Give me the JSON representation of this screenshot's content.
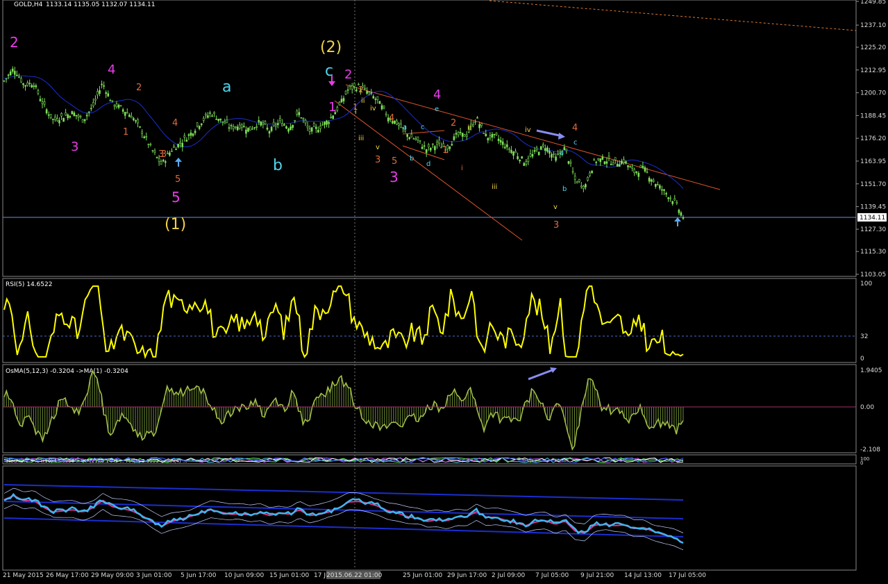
{
  "window": {
    "symbol_title": "GOLD,H4",
    "ohlc": "1133.14 1135.05 1132.07 1134.11",
    "last_price": "1134.11",
    "date_tag": "2015.06.22 01:00"
  },
  "panels": {
    "rsi_label": "RSI(5) 14.6522",
    "osma_label": "OsMA(5,12,3) -0.3204  ->MA(1) -0.3204",
    "stoch_label": "Stoch.3.1.9 ... ((10) 13.6356 ... MA(21) 3.1442 ... MA(1) 2.3553 ... MA(4) ..."
  },
  "colors": {
    "background": "#000000",
    "candles": "#7fe15a",
    "ma_blue": "#1a2fd0",
    "rsi": "#ffff00",
    "osma": "#6e8a33",
    "channel": "#e0552c",
    "magenta": "#e83ce8",
    "cyan": "#4dd6ef",
    "wave_yellow": "#f2d34a",
    "wave_orange": "#e06b3c",
    "arrow_purple": "#8a8cf0",
    "arrow_blue": "#5aa9ef"
  },
  "chart_data": {
    "type": "candlestick",
    "timeframe": "H4",
    "price_axis_ticks": [
      1249.85,
      1237.1,
      1225.2,
      1212.95,
      1200.7,
      1188.45,
      1176.2,
      1163.95,
      1151.7,
      1139.45,
      1127.3,
      1115.3,
      1103.05
    ],
    "price_tick_labels": [
      "1249.85",
      "1237.10",
      "1225.20",
      "1212.95",
      "1200.70",
      "1188.45",
      "1176.20",
      "1163.95",
      "1151.70",
      "1139.45",
      "1127.30",
      "1115.30",
      "1103.05"
    ],
    "time_labels": [
      "21 May 2015",
      "26 May 17:00",
      "29 May 09:00",
      "3 Jun 01:00",
      "5 Jun 17:00",
      "10 Jun 09:00",
      "15 Jun 01:00",
      "17 Jun",
      "2015.06.22 01:00",
      "25 Jun 01:00",
      "29 Jun 17:00",
      "2 Jul 09:00",
      "7 Jul 05:00",
      "9 Jul 21:00",
      "14 Jul 13:00",
      "17 Jul 05:00"
    ],
    "rsi_levels": [
      100,
      32,
      0
    ],
    "rsi_tick_labels": [
      "100",
      "32",
      "0"
    ],
    "osma_levels": [
      1.9405,
      0.0,
      -2.108
    ],
    "osma_tick_labels": [
      "1.9405",
      "0.00",
      "-2.108"
    ],
    "stoch_tick_labels": [
      "100",
      "0"
    ],
    "price_path": [
      [
        0,
        1207
      ],
      [
        2,
        1214
      ],
      [
        4,
        1205
      ],
      [
        6,
        1206
      ],
      [
        8,
        1194
      ],
      [
        10,
        1186
      ],
      [
        12,
        1188
      ],
      [
        14,
        1190
      ],
      [
        16,
        1186
      ],
      [
        18,
        1193
      ],
      [
        20,
        1206
      ],
      [
        22,
        1195
      ],
      [
        24,
        1192
      ],
      [
        26,
        1188
      ],
      [
        28,
        1180
      ],
      [
        30,
        1170
      ],
      [
        32,
        1162
      ],
      [
        34,
        1170
      ],
      [
        36,
        1174
      ],
      [
        38,
        1179
      ],
      [
        40,
        1185
      ],
      [
        42,
        1190
      ],
      [
        44,
        1186
      ],
      [
        46,
        1182
      ],
      [
        48,
        1183
      ],
      [
        50,
        1181
      ],
      [
        52,
        1185
      ],
      [
        54,
        1180
      ],
      [
        56,
        1185
      ],
      [
        58,
        1182
      ],
      [
        60,
        1190
      ],
      [
        62,
        1180
      ],
      [
        64,
        1182
      ],
      [
        66,
        1186
      ],
      [
        68,
        1193
      ],
      [
        70,
        1203
      ],
      [
        72,
        1204
      ],
      [
        74,
        1201
      ],
      [
        76,
        1196
      ],
      [
        78,
        1188
      ],
      [
        80,
        1184
      ],
      [
        82,
        1178
      ],
      [
        84,
        1175
      ],
      [
        86,
        1170
      ],
      [
        88,
        1173
      ],
      [
        90,
        1171
      ],
      [
        92,
        1178
      ],
      [
        94,
        1178
      ],
      [
        96,
        1187
      ],
      [
        98,
        1177
      ],
      [
        100,
        1177
      ],
      [
        102,
        1172
      ],
      [
        104,
        1168
      ],
      [
        106,
        1163
      ],
      [
        108,
        1169
      ],
      [
        110,
        1172
      ],
      [
        112,
        1165
      ],
      [
        114,
        1171
      ],
      [
        116,
        1154
      ],
      [
        118,
        1150
      ],
      [
        120,
        1164
      ],
      [
        122,
        1165
      ],
      [
        124,
        1163
      ],
      [
        126,
        1164
      ],
      [
        128,
        1158
      ],
      [
        130,
        1160
      ],
      [
        132,
        1153
      ],
      [
        134,
        1148
      ],
      [
        136,
        1143
      ],
      [
        138,
        1134
      ]
    ],
    "wave_labels": [
      {
        "text": "2",
        "color": "magenta"
      },
      {
        "text": "4",
        "color": "magenta"
      },
      {
        "text": "3",
        "color": "magenta"
      },
      {
        "text": "5",
        "color": "magenta"
      },
      {
        "text": "(1)",
        "color": "wave_yellow"
      },
      {
        "text": "a",
        "color": "cyan"
      },
      {
        "text": "b",
        "color": "cyan"
      },
      {
        "text": "(2)",
        "color": "wave_yellow"
      },
      {
        "text": "c",
        "color": "cyan"
      },
      {
        "text": "1",
        "color": "magenta"
      },
      {
        "text": "3",
        "color": "magenta"
      },
      {
        "text": "2",
        "color": "wave_orange"
      },
      {
        "text": "1",
        "color": "wave_orange"
      },
      {
        "text": "3",
        "color": "wave_orange"
      },
      {
        "text": "4",
        "color": "wave_orange"
      },
      {
        "text": "5",
        "color": "wave_orange"
      },
      {
        "text": "i",
        "color": "wave_orange"
      },
      {
        "text": "ii",
        "color": "wave_yellow"
      },
      {
        "text": "iii",
        "color": "wave_yellow"
      },
      {
        "text": "iv",
        "color": "wave_yellow"
      },
      {
        "text": "v",
        "color": "wave_yellow"
      },
      {
        "text": "a",
        "color": "cyan"
      },
      {
        "text": "b",
        "color": "cyan"
      },
      {
        "text": "c",
        "color": "cyan"
      },
      {
        "text": "d",
        "color": "cyan"
      },
      {
        "text": "e",
        "color": "cyan"
      }
    ]
  }
}
